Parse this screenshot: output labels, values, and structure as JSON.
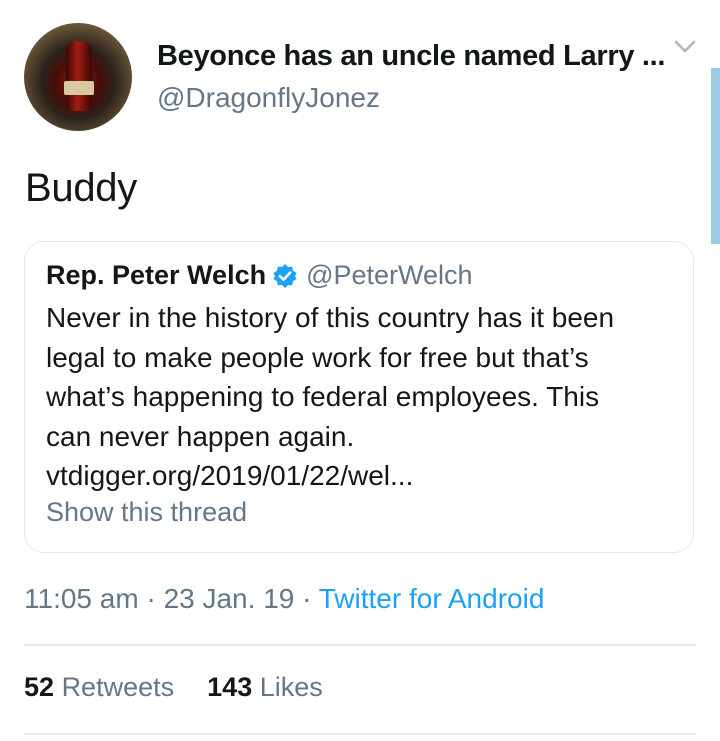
{
  "tweet": {
    "display_name": "Beyonce has an uncle named Larry ...",
    "handle": "@DragonflyJonez",
    "text": "Buddy",
    "timestamp": "11:05 am",
    "date": "23 Jan. 19",
    "separator": "·",
    "source": "Twitter for Android",
    "retweets_count": "52",
    "retweets_label": "Retweets",
    "likes_count": "143",
    "likes_label": "Likes"
  },
  "quoted_tweet": {
    "display_name": "Rep. Peter Welch",
    "handle": "@PeterWelch",
    "lines": [
      "Never in the history of this country has it been",
      "legal to make people work for free but that’s",
      "what’s happening to federal employees. This",
      "can never happen again.",
      "vtdigger.org/2019/01/22/wel..."
    ],
    "show_thread": "Show this thread"
  },
  "icons": {
    "menu": "chevron-down-icon",
    "verified": "verified-badge-icon"
  },
  "colors": {
    "link": "#1da1f2",
    "secondary_text": "#657786",
    "border": "#e1e8ed",
    "scrollbar": "#9ccbe4"
  }
}
